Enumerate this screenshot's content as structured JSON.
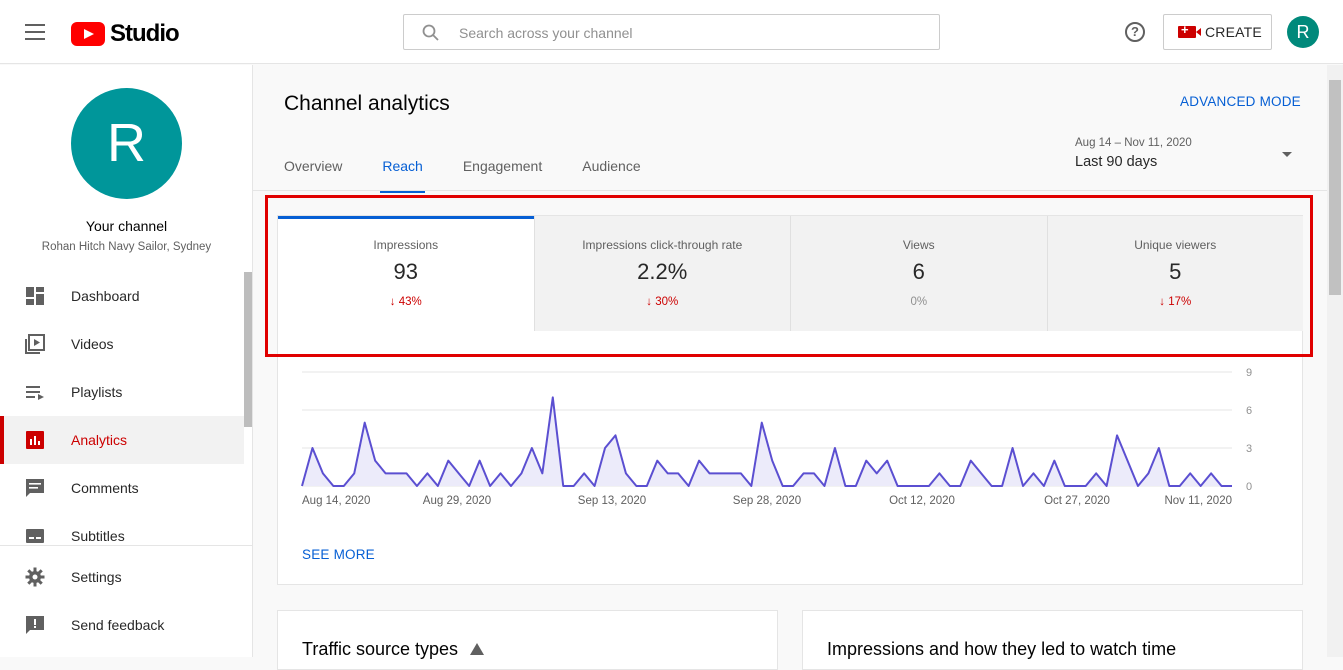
{
  "header": {
    "logo_text": "Studio",
    "search_placeholder": "Search across your channel",
    "help_glyph": "?",
    "create_label": "CREATE",
    "avatar_letter": "R"
  },
  "sidebar": {
    "avatar_letter": "R",
    "channel_title": "Your channel",
    "channel_subtitle": "Rohan Hitch Navy Sailor, Sydney",
    "items": [
      {
        "label": "Dashboard",
        "icon": "dashboard-icon",
        "active": false
      },
      {
        "label": "Videos",
        "icon": "videos-icon",
        "active": false
      },
      {
        "label": "Playlists",
        "icon": "playlists-icon",
        "active": false
      },
      {
        "label": "Analytics",
        "icon": "analytics-icon",
        "active": true
      },
      {
        "label": "Comments",
        "icon": "comments-icon",
        "active": false
      },
      {
        "label": "Subtitles",
        "icon": "subtitles-icon",
        "active": false
      }
    ],
    "bottom_items": [
      {
        "label": "Settings",
        "icon": "gear-icon"
      },
      {
        "label": "Send feedback",
        "icon": "feedback-icon"
      }
    ]
  },
  "main": {
    "title": "Channel analytics",
    "advanced_mode": "ADVANCED MODE",
    "tabs": [
      {
        "label": "Overview",
        "active": false
      },
      {
        "label": "Reach",
        "active": true
      },
      {
        "label": "Engagement",
        "active": false
      },
      {
        "label": "Audience",
        "active": false
      }
    ],
    "date_range": "Aug 14 – Nov 11, 2020",
    "date_label": "Last 90 days",
    "metrics": [
      {
        "label": "Impressions",
        "value": "93",
        "delta": "↓ 43%",
        "trend": "down"
      },
      {
        "label": "Impressions click-through rate",
        "value": "2.2%",
        "delta": "↓ 30%",
        "trend": "down"
      },
      {
        "label": "Views",
        "value": "6",
        "delta": "0%",
        "trend": "flat"
      },
      {
        "label": "Unique viewers",
        "value": "5",
        "delta": "↓ 17%",
        "trend": "down"
      }
    ],
    "see_more": "SEE MORE",
    "panels": [
      {
        "title": "Traffic source types"
      },
      {
        "title": "Impressions and how they led to watch time"
      }
    ]
  },
  "colors": {
    "accent": "#065fd4",
    "brand_red": "#cc0000",
    "highlight_box": "#e00000",
    "series_line": "#5b4fd1",
    "series_fill": "#ecebfa"
  },
  "chart_data": {
    "type": "area",
    "x_ticks": [
      "Aug 14, 2020",
      "Aug 29, 2020",
      "Sep 13, 2020",
      "Sep 28, 2020",
      "Oct 12, 2020",
      "Oct 27, 2020",
      "Nov 11, 2020"
    ],
    "y_ticks": [
      0,
      3,
      6,
      9
    ],
    "ylim": [
      0,
      9
    ],
    "grid": true,
    "series": [
      {
        "values": [
          0,
          3,
          1,
          0,
          0,
          1,
          5,
          2,
          1,
          1,
          1,
          0,
          1,
          0,
          2,
          1,
          0,
          2,
          0,
          1,
          0,
          1,
          3,
          1,
          7,
          0,
          0,
          1,
          0,
          3,
          4,
          1,
          0,
          0,
          2,
          1,
          1,
          0,
          2,
          1,
          1,
          1,
          1,
          0,
          5,
          2,
          0,
          0,
          1,
          1,
          0,
          3,
          0,
          0,
          2,
          1,
          2,
          0,
          0,
          0,
          0,
          1,
          0,
          0,
          2,
          1,
          0,
          0,
          3,
          0,
          1,
          0,
          2,
          0,
          0,
          0,
          1,
          0,
          4,
          2,
          0,
          1,
          3,
          0,
          0,
          1,
          0,
          1,
          0,
          0
        ]
      }
    ]
  }
}
